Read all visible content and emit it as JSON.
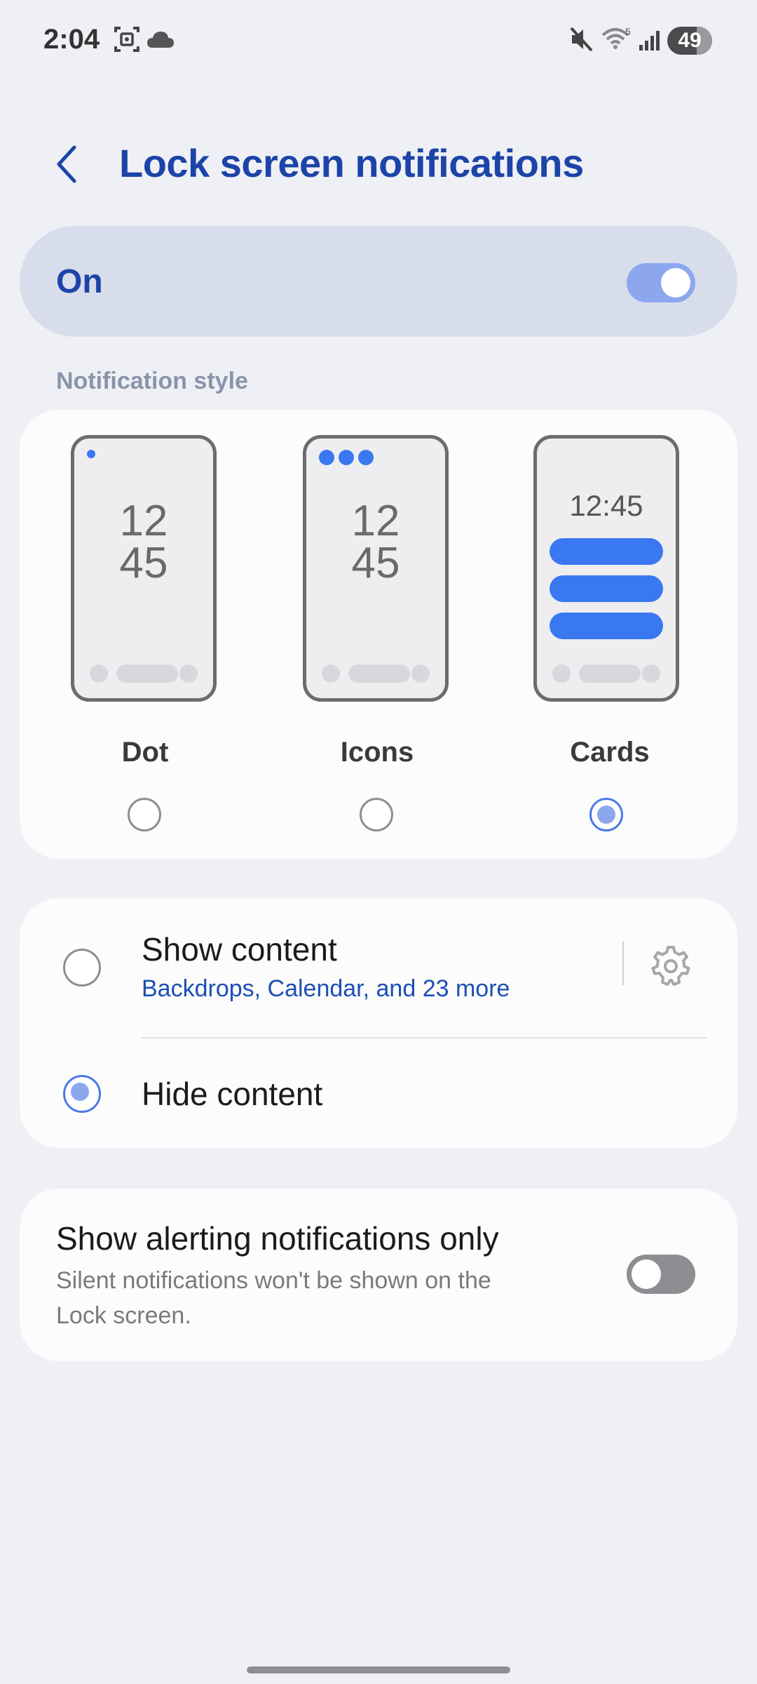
{
  "status_bar": {
    "time": "2:04",
    "battery": "49",
    "icons": [
      "screenshot-icon",
      "cloud-icon",
      "mute-icon",
      "wifi-icon",
      "signal-icon",
      "battery-icon"
    ]
  },
  "header": {
    "title": "Lock screen notifications",
    "back_icon": "back-chevron-icon"
  },
  "master": {
    "label": "On",
    "enabled": true
  },
  "notification_style": {
    "label": "Notification style",
    "options": [
      {
        "label": "Dot",
        "clock_top": "12",
        "clock_bottom": "45",
        "selected": false
      },
      {
        "label": "Icons",
        "clock_top": "12",
        "clock_bottom": "45",
        "selected": false
      },
      {
        "label": "Cards",
        "clock": "12:45",
        "selected": true
      }
    ]
  },
  "content": {
    "show": {
      "title": "Show content",
      "subtitle": "Backdrops, Calendar, and 23 more",
      "selected": false
    },
    "hide": {
      "title": "Hide content",
      "selected": true
    }
  },
  "alerting": {
    "title": "Show alerting notifications only",
    "subtitle_line1": "Silent notifications won't be shown on the",
    "subtitle_line2": "Lock screen.",
    "enabled": false
  },
  "colors": {
    "accent": "#1c44a8",
    "switch_on": "#8ca7ee",
    "card_blue": "#3a78f2",
    "background": "#eff0f5"
  }
}
